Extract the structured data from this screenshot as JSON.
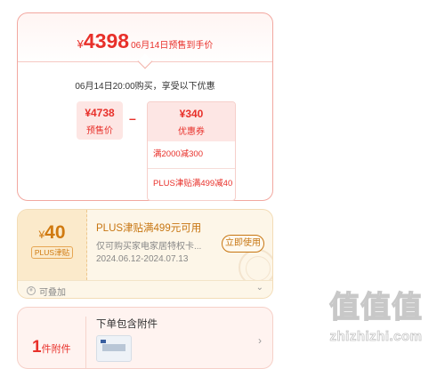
{
  "price_breakdown": {
    "final_price_symbol": "¥",
    "final_price": "4398",
    "final_price_note": "06月14日预售到手价",
    "purchase_time": "06月14日20:00购买，享受以下优惠",
    "presale_price": "¥4738",
    "presale_label": "预售价",
    "minus": "–",
    "coupon_value": "¥340",
    "coupon_label": "优惠券",
    "coupon_rules": [
      "满2000减300",
      "PLUS津贴满499减40"
    ]
  },
  "plus_subsidy": {
    "amount_symbol": "¥",
    "amount": "40",
    "tag": "PLUS津贴",
    "title": "PLUS津贴满499元可用",
    "description": "仅可购买家电家居特权卡...",
    "validity": "2024.06.12-2024.07.13",
    "use_button": "立即使用",
    "stackable_icon": "¥",
    "stackable": "可叠加",
    "expand_icon": "⌄"
  },
  "accessories": {
    "count": "1",
    "count_unit": "件附件",
    "title": "下单包含附件",
    "chevron": "›"
  },
  "watermark": {
    "logo": "值值值",
    "url": "zhizhizhi.com"
  },
  "colors": {
    "accent_red": "#e8302a",
    "plus_gold": "#c77612"
  }
}
